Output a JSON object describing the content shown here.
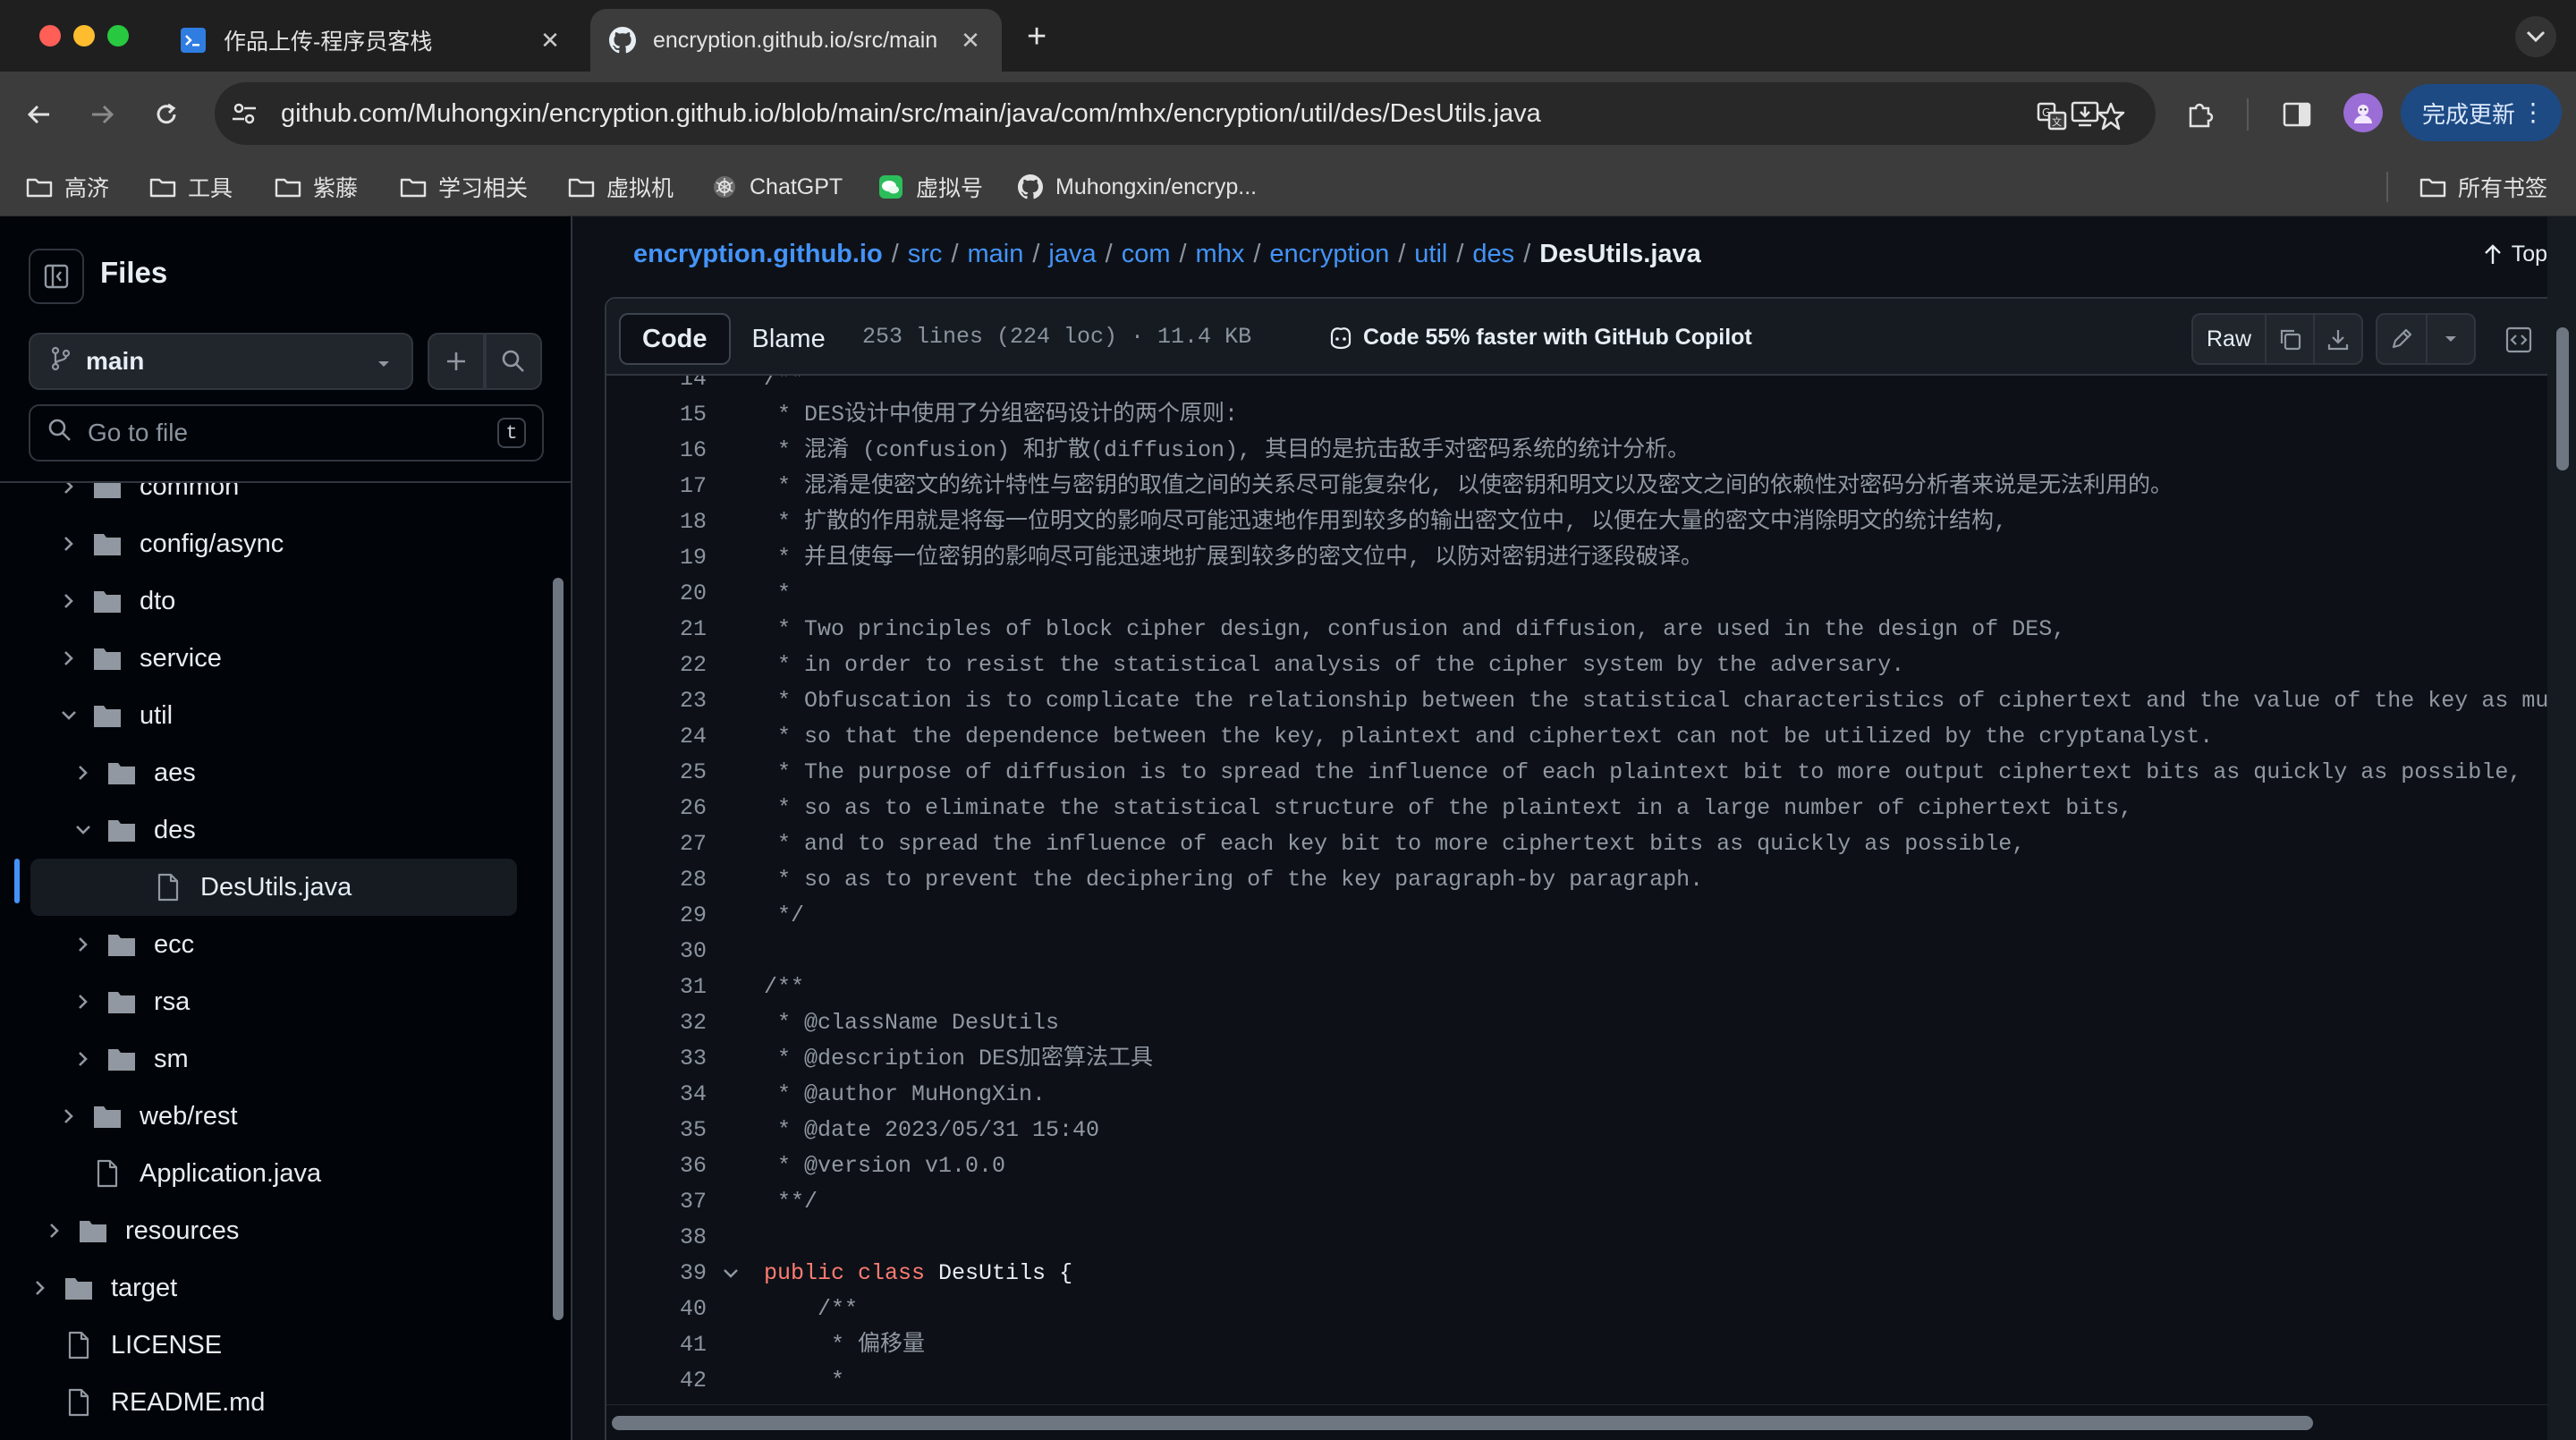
{
  "browser": {
    "tabs": [
      {
        "title": "作品上传-程序员客栈"
      },
      {
        "title": "encryption.github.io/src/main"
      }
    ],
    "url": "github.com/Muhongxin/encryption.github.io/blob/main/src/main/java/com/mhx/encryption/util/des/DesUtils.java",
    "update_label": "完成更新",
    "bookmarks": [
      {
        "label": "高济",
        "icon": "folder-icon"
      },
      {
        "label": "工具",
        "icon": "folder-icon"
      },
      {
        "label": "紫藤",
        "icon": "folder-icon"
      },
      {
        "label": "学习相关",
        "icon": "folder-icon"
      },
      {
        "label": "虚拟机",
        "icon": "folder-icon"
      },
      {
        "label": "ChatGPT",
        "icon": "chatgpt-icon"
      },
      {
        "label": "虚拟号",
        "icon": "wechat-icon"
      },
      {
        "label": "Muhongxin/encryp...",
        "icon": "github-icon"
      }
    ],
    "all_bookmarks_label": "所有书签"
  },
  "sidebar": {
    "title": "Files",
    "branch": "main",
    "search_placeholder": "Go to file",
    "search_shortcut": "t",
    "tree": [
      {
        "label": "common",
        "type": "folder",
        "depth": 1,
        "expanded": false
      },
      {
        "label": "config/async",
        "type": "folder",
        "depth": 1,
        "expanded": false
      },
      {
        "label": "dto",
        "type": "folder",
        "depth": 1,
        "expanded": false
      },
      {
        "label": "service",
        "type": "folder",
        "depth": 1,
        "expanded": false
      },
      {
        "label": "util",
        "type": "folder",
        "depth": 1,
        "expanded": true
      },
      {
        "label": "aes",
        "type": "folder",
        "depth": 2,
        "expanded": false
      },
      {
        "label": "des",
        "type": "folder",
        "depth": 2,
        "expanded": true
      },
      {
        "label": "DesUtils.java",
        "type": "file",
        "depth": 3,
        "selected": true
      },
      {
        "label": "ecc",
        "type": "folder",
        "depth": 2,
        "expanded": false
      },
      {
        "label": "rsa",
        "type": "folder",
        "depth": 2,
        "expanded": false
      },
      {
        "label": "sm",
        "type": "folder",
        "depth": 2,
        "expanded": false
      },
      {
        "label": "web/rest",
        "type": "folder",
        "depth": 1,
        "expanded": false
      },
      {
        "label": "Application.java",
        "type": "file",
        "depth": 1
      },
      {
        "label": "resources",
        "type": "folder",
        "depth": 0,
        "expanded": false
      },
      {
        "label": "target",
        "type": "folder",
        "depth": -1,
        "expanded": false
      },
      {
        "label": "LICENSE",
        "type": "file",
        "depth": -1
      },
      {
        "label": "README.md",
        "type": "file",
        "depth": -1
      }
    ]
  },
  "main": {
    "breadcrumb": [
      "encryption.github.io",
      "src",
      "main",
      "java",
      "com",
      "mhx",
      "encryption",
      "util",
      "des"
    ],
    "current_file": "DesUtils.java",
    "top_label": "Top",
    "code_tab": "Code",
    "blame_tab": "Blame",
    "file_info": "253 lines (224 loc) · 11.4 KB",
    "copilot_text": "Code 55% faster with GitHub Copilot",
    "raw_label": "Raw",
    "code_lines": [
      {
        "n": "14",
        "parts": [
          {
            "t": "/**",
            "c": "cm"
          }
        ]
      },
      {
        "n": "15",
        "parts": [
          {
            "t": " * DES设计中使用了分组密码设计的两个原则:",
            "c": "cm"
          }
        ]
      },
      {
        "n": "16",
        "parts": [
          {
            "t": " * 混淆 (confusion) 和扩散(diffusion), 其目的是抗击敌手对密码系统的统计分析。",
            "c": "cm"
          }
        ]
      },
      {
        "n": "17",
        "parts": [
          {
            "t": " * 混淆是使密文的统计特性与密钥的取值之间的关系尽可能复杂化, 以使密钥和明文以及密文之间的依赖性对密码分析者来说是无法利用的。",
            "c": "cm"
          }
        ]
      },
      {
        "n": "18",
        "parts": [
          {
            "t": " * 扩散的作用就是将每一位明文的影响尽可能迅速地作用到较多的输出密文位中, 以便在大量的密文中消除明文的统计结构,",
            "c": "cm"
          }
        ]
      },
      {
        "n": "19",
        "parts": [
          {
            "t": " * 并且使每一位密钥的影响尽可能迅速地扩展到较多的密文位中, 以防对密钥进行逐段破译。",
            "c": "cm"
          }
        ]
      },
      {
        "n": "20",
        "parts": [
          {
            "t": " *",
            "c": "cm"
          }
        ]
      },
      {
        "n": "21",
        "parts": [
          {
            "t": " * Two principles of block cipher design, confusion and diffusion, are used in the design of DES,",
            "c": "cm"
          }
        ]
      },
      {
        "n": "22",
        "parts": [
          {
            "t": " * in order to resist the statistical analysis of the cipher system by the adversary.",
            "c": "cm"
          }
        ]
      },
      {
        "n": "23",
        "parts": [
          {
            "t": " * Obfuscation is to complicate the relationship between the statistical characteristics of ciphertext and the value of the key as much",
            "c": "cm"
          }
        ]
      },
      {
        "n": "24",
        "parts": [
          {
            "t": " * so that the dependence between the key, plaintext and ciphertext can not be utilized by the cryptanalyst.",
            "c": "cm"
          }
        ]
      },
      {
        "n": "25",
        "parts": [
          {
            "t": " * The purpose of diffusion is to spread the influence of each plaintext bit to more output ciphertext bits as quickly as possible,",
            "c": "cm"
          }
        ]
      },
      {
        "n": "26",
        "parts": [
          {
            "t": " * so as to eliminate the statistical structure of the plaintext in a large number of ciphertext bits,",
            "c": "cm"
          }
        ]
      },
      {
        "n": "27",
        "parts": [
          {
            "t": " * and to spread the influence of each key bit to more ciphertext bits as quickly as possible,",
            "c": "cm"
          }
        ]
      },
      {
        "n": "28",
        "parts": [
          {
            "t": " * so as to prevent the deciphering of the key paragraph-by paragraph.",
            "c": "cm"
          }
        ]
      },
      {
        "n": "29",
        "parts": [
          {
            "t": " */",
            "c": "cm"
          }
        ]
      },
      {
        "n": "30",
        "parts": []
      },
      {
        "n": "31",
        "parts": [
          {
            "t": "/**",
            "c": "cm"
          }
        ]
      },
      {
        "n": "32",
        "parts": [
          {
            "t": " * @className DesUtils",
            "c": "cm"
          }
        ]
      },
      {
        "n": "33",
        "parts": [
          {
            "t": " * @description DES加密算法工具",
            "c": "cm"
          }
        ]
      },
      {
        "n": "34",
        "parts": [
          {
            "t": " * @author MuHongXin.",
            "c": "cm"
          }
        ]
      },
      {
        "n": "35",
        "parts": [
          {
            "t": " * @date 2023/05/31 15:40",
            "c": "cm"
          }
        ]
      },
      {
        "n": "36",
        "parts": [
          {
            "t": " * @version v1.0.0",
            "c": "cm"
          }
        ]
      },
      {
        "n": "37",
        "parts": [
          {
            "t": " **/",
            "c": "cm"
          }
        ]
      },
      {
        "n": "38",
        "parts": []
      },
      {
        "n": "39",
        "fold": true,
        "parts": [
          {
            "t": "public class",
            "c": "kw"
          },
          {
            "t": " DesUtils",
            "c": "cn"
          },
          {
            "t": " {",
            "c": "pl"
          }
        ]
      },
      {
        "n": "40",
        "parts": [
          {
            "t": "    /**",
            "c": "cm"
          }
        ]
      },
      {
        "n": "41",
        "parts": [
          {
            "t": "     * 偏移量",
            "c": "cm"
          }
        ]
      },
      {
        "n": "42",
        "parts": [
          {
            "t": "     *",
            "c": "cm"
          }
        ]
      }
    ]
  },
  "colors": {
    "link": "#4493f8",
    "keyword": "#ff7b72",
    "comment": "#9198a1",
    "background": "#0d1117",
    "border": "#30363d"
  }
}
